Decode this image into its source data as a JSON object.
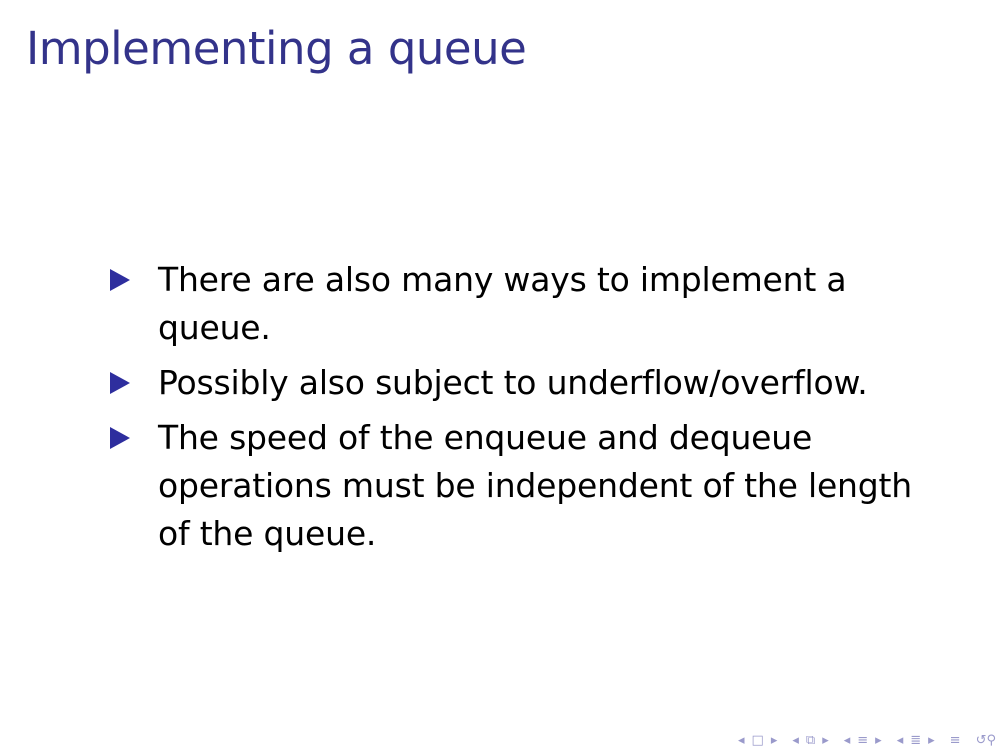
{
  "slide": {
    "title": "Implementing a queue",
    "title_color": "#33338a",
    "bullet_color": "#2e2e9e",
    "bullets": [
      "There are also many ways to implement a queue.",
      "Possibly also subject to underflow/overflow.",
      "The speed of the enqueue and dequeue operations must be independent of the length of the queue."
    ]
  },
  "navigation": {
    "icons": [
      "nav-left-arrow-icon",
      "nav-slide-icon",
      "nav-right-arrow-icon",
      "nav-left-arrow-icon",
      "nav-frame-icon",
      "nav-right-arrow-icon",
      "nav-left-arrow-icon",
      "nav-section-icon",
      "nav-right-arrow-icon",
      "nav-left-arrow-icon",
      "nav-subsection-icon",
      "nav-right-arrow-icon",
      "nav-align-icon",
      "nav-search-icon"
    ]
  }
}
